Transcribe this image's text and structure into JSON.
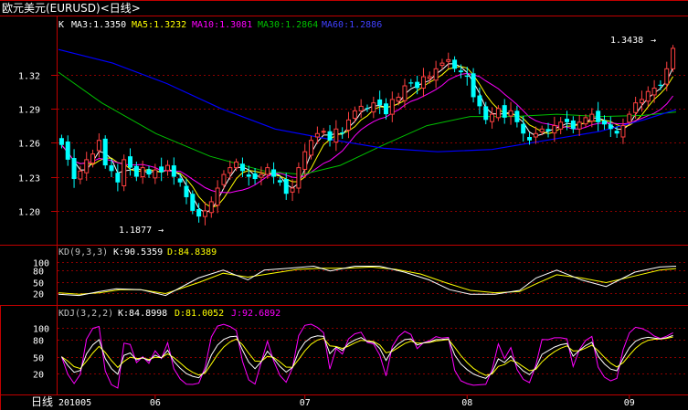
{
  "window": {
    "title": "欧元美元(EURUSD)<日线>"
  },
  "main_legend": {
    "prefix": "K",
    "ma3": "MA3:1.3350",
    "ma5": "MA5:1.3232",
    "ma10": "MA10:1.3081",
    "ma30": "MA30:1.2864",
    "ma60": "MA60:1.2886"
  },
  "kd_legend": {
    "prefix": "KD(9,3,3)",
    "k": "K:90.5359",
    "d": "D:84.8389"
  },
  "kdj_legend": {
    "prefix": "KDJ(3,2,2)",
    "k": "K:84.8998",
    "d": "D:81.0052",
    "j": "J:92.6892"
  },
  "annotations": {
    "high": "1.3438",
    "low": "1.1877",
    "arrow": "→"
  },
  "colors": {
    "candle_up": "#ff4040",
    "candle_down": "#00ffff",
    "ma3": "#ffffff",
    "ma5": "#ffff00",
    "ma10": "#ff00ff",
    "ma30": "#00c000",
    "ma60": "#0000ff",
    "grid": "#8b0000",
    "axis": "#c00000"
  },
  "chart_data": [
    {
      "type": "candlestick",
      "ylim": [
        1.175,
        1.355
      ],
      "yticks": [
        "1.32",
        "1.29",
        "1.26",
        "1.23",
        "1.20"
      ],
      "ytick_values": [
        1.32,
        1.29,
        1.26,
        1.23,
        1.2
      ],
      "x_start_label": "201005",
      "x_months": [
        "06",
        "07",
        "08",
        "09"
      ],
      "x_month_index": [
        15,
        39,
        65,
        91
      ],
      "high": 1.3438,
      "low": 1.1877,
      "closes": [
        1.258,
        1.245,
        1.228,
        1.235,
        1.245,
        1.25,
        1.262,
        1.24,
        1.235,
        1.225,
        1.245,
        1.238,
        1.23,
        1.238,
        1.232,
        1.236,
        1.234,
        1.24,
        1.23,
        1.225,
        1.212,
        1.2,
        1.195,
        1.2,
        1.208,
        1.22,
        1.232,
        1.238,
        1.243,
        1.235,
        1.23,
        1.228,
        1.232,
        1.238,
        1.23,
        1.225,
        1.215,
        1.22,
        1.238,
        1.252,
        1.262,
        1.268,
        1.27,
        1.262,
        1.272,
        1.268,
        1.28,
        1.288,
        1.292,
        1.29,
        1.295,
        1.293,
        1.285,
        1.298,
        1.3,
        1.31,
        1.312,
        1.308,
        1.318,
        1.318,
        1.325,
        1.33,
        1.333,
        1.325,
        1.322,
        1.318,
        1.3,
        1.292,
        1.28,
        1.285,
        1.29,
        1.282,
        1.288,
        1.278,
        1.268,
        1.262,
        1.268,
        1.272,
        1.27,
        1.275,
        1.278,
        1.278,
        1.272,
        1.278,
        1.282,
        1.285,
        1.278,
        1.276,
        1.272,
        1.268,
        1.275,
        1.285,
        1.295,
        1.298,
        1.305,
        1.308,
        1.31,
        1.325,
        1.343
      ],
      "series_names": [
        "MA3",
        "MA5",
        "MA10",
        "MA30",
        "MA60"
      ],
      "ma30_points": [
        [
          0,
          1.322
        ],
        [
          8,
          1.295
        ],
        [
          18,
          1.268
        ],
        [
          28,
          1.248
        ],
        [
          38,
          1.235
        ],
        [
          45,
          1.232
        ],
        [
          52,
          1.24
        ],
        [
          60,
          1.258
        ],
        [
          68,
          1.275
        ],
        [
          76,
          1.283
        ],
        [
          84,
          1.283
        ],
        [
          92,
          1.285
        ],
        [
          100,
          1.283
        ],
        [
          108,
          1.284
        ],
        [
          114,
          1.287
        ]
      ],
      "ma60_points": [
        [
          0,
          1.342
        ],
        [
          10,
          1.33
        ],
        [
          20,
          1.312
        ],
        [
          30,
          1.29
        ],
        [
          40,
          1.272
        ],
        [
          50,
          1.263
        ],
        [
          60,
          1.255
        ],
        [
          70,
          1.252
        ],
        [
          80,
          1.254
        ],
        [
          90,
          1.262
        ],
        [
          100,
          1.27
        ],
        [
          108,
          1.28
        ],
        [
          114,
          1.289
        ]
      ]
    },
    {
      "type": "line",
      "name": "KD(9,3,3)",
      "ylim": [
        0,
        110
      ],
      "yticks": [
        "100",
        "80",
        "50",
        "20"
      ],
      "ytick_values": [
        100,
        80,
        50,
        20
      ],
      "k_points": [
        [
          0,
          18
        ],
        [
          5,
          15
        ],
        [
          10,
          25
        ],
        [
          14,
          32
        ],
        [
          20,
          30
        ],
        [
          26,
          15
        ],
        [
          34,
          60
        ],
        [
          40,
          80
        ],
        [
          46,
          55
        ],
        [
          50,
          80
        ],
        [
          56,
          85
        ],
        [
          62,
          90
        ],
        [
          66,
          78
        ],
        [
          72,
          90
        ],
        [
          78,
          90
        ],
        [
          84,
          75
        ],
        [
          90,
          55
        ],
        [
          95,
          30
        ],
        [
          100,
          18
        ],
        [
          106,
          18
        ],
        [
          112,
          28
        ],
        [
          116,
          60
        ],
        [
          121,
          80
        ],
        [
          127,
          55
        ],
        [
          133,
          38
        ],
        [
          140,
          75
        ],
        [
          146,
          88
        ],
        [
          150,
          90
        ]
      ],
      "d_points": [
        [
          0,
          22
        ],
        [
          5,
          18
        ],
        [
          10,
          22
        ],
        [
          15,
          30
        ],
        [
          20,
          30
        ],
        [
          26,
          20
        ],
        [
          34,
          48
        ],
        [
          40,
          72
        ],
        [
          46,
          62
        ],
        [
          52,
          72
        ],
        [
          58,
          82
        ],
        [
          64,
          85
        ],
        [
          70,
          85
        ],
        [
          76,
          88
        ],
        [
          82,
          82
        ],
        [
          88,
          70
        ],
        [
          94,
          48
        ],
        [
          100,
          28
        ],
        [
          106,
          22
        ],
        [
          112,
          25
        ],
        [
          116,
          45
        ],
        [
          121,
          68
        ],
        [
          127,
          60
        ],
        [
          133,
          48
        ],
        [
          140,
          65
        ],
        [
          146,
          80
        ],
        [
          150,
          84
        ]
      ]
    },
    {
      "type": "line",
      "name": "KDJ(3,2,2)",
      "ylim": [
        -10,
        115
      ],
      "yticks": [
        "100",
        "80",
        "50",
        "20"
      ],
      "ytick_values": [
        100,
        80,
        50,
        20
      ],
      "note": "K (white), D (yellow), J (magenta) oscillator lines drawn across the panel"
    }
  ]
}
